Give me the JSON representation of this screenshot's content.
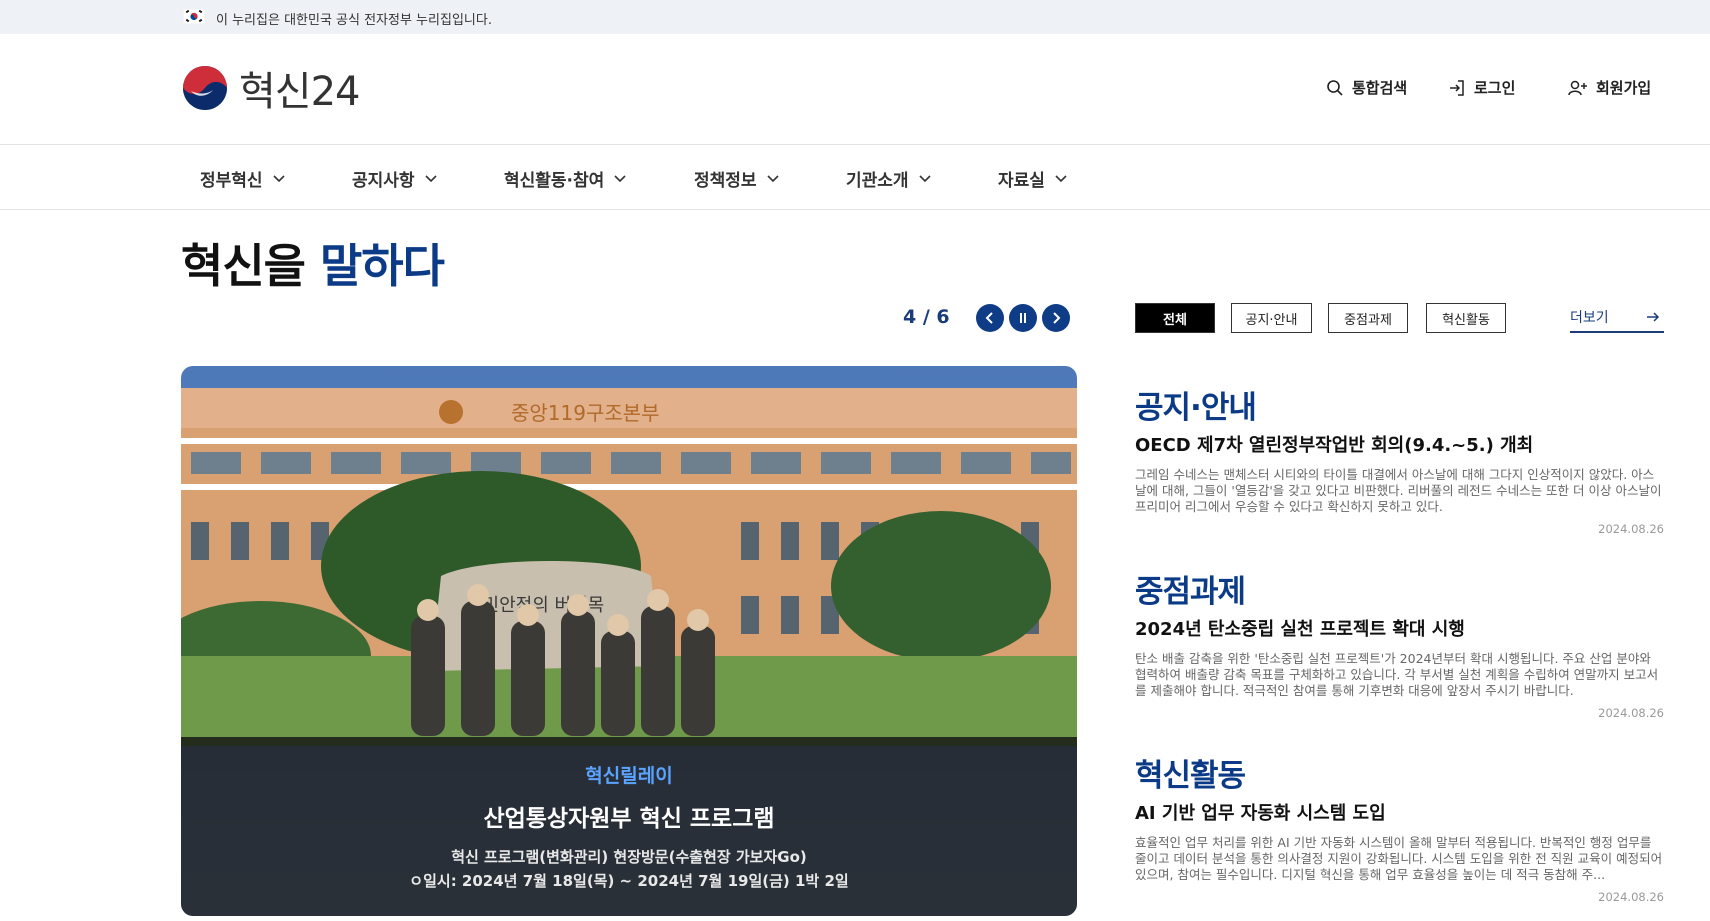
{
  "gov_bar": {
    "text": "이 누리집은 대한민국 공식 전자정부 누리집입니다."
  },
  "header": {
    "logo_text": "혁신24",
    "search_label": "통합검색",
    "login_label": "로그인",
    "join_label": "회원가입"
  },
  "gnb": {
    "items": [
      {
        "label": "정부혁신"
      },
      {
        "label": "공지사항"
      },
      {
        "label": "혁신활동·참여"
      },
      {
        "label": "정책정보"
      },
      {
        "label": "기관소개"
      },
      {
        "label": "자료실"
      }
    ]
  },
  "page_title": {
    "part1": "혁신을 ",
    "part2": "말하다"
  },
  "slider": {
    "current": "4",
    "separator": " / ",
    "total": "6",
    "category": "혁신릴레이",
    "title": "산업통상자원부 혁신 프로그램",
    "desc1": "혁신 프로그램(변화관리) 현장방문(수출현장 가보자Go)",
    "desc2": "ㅇ일시: 2024년 7월 18일(목) ~ 2024년 7월 19일(금) 1박 2일",
    "photo_sign": "국민안전의 버팀목",
    "photo_building": "중앙119구조본부"
  },
  "tabs": [
    {
      "label": "전체"
    },
    {
      "label": "공지·안내"
    },
    {
      "label": "중점과제"
    },
    {
      "label": "혁신활동"
    }
  ],
  "more_label": "더보기",
  "news": [
    {
      "category": "공지·안내",
      "title": "OECD 제7차 열린정부작업반 회의(9.4.~5.) 개최",
      "body": "그레임 수네스는 맨체스터 시티와의 타이틀 대결에서 아스날에 대해 그다지 인상적이지 않았다. 아스날에 대해, 그들이 '열등감'을 갖고 있다고 비판했다. 리버풀의 레전드 수네스는 또한 더 이상 아스날이 프리미어 리그에서 우승할 수 있다고 확신하지 못하고 있다.",
      "date": "2024.08.26"
    },
    {
      "category": "중점과제",
      "title": "2024년 탄소중립 실천 프로젝트 확대 시행",
      "body": "탄소 배출 감축을 위한 '탄소중립 실천 프로젝트'가 2024년부터 확대 시행됩니다. 주요 산업 분야와 협력하여 배출량 감축 목표를 구체화하고 있습니다. 각 부서별 실천 계획을 수립하여 연말까지 보고서를 제출해야 합니다. 적극적인 참여를 통해 기후변화 대응에 앞장서 주시기 바랍니다.",
      "date": "2024.08.26"
    },
    {
      "category": "혁신활동",
      "title": "AI 기반 업무 자동화 시스템 도입",
      "body": "효율적인 업무 처리를 위한 AI 기반 자동화 시스템이 올해 말부터 적용됩니다. 반복적인 행정 업무를 줄이고 데이터 분석을 통한 의사결정 지원이 강화됩니다. 시스템 도입을 위한 전 직원 교육이 예정되어 있으며, 참여는 필수입니다. 디지털 혁신을 통해 업무 효율성을 높이는 데 적극 동참해 주...",
      "date": "2024.08.26"
    }
  ]
}
